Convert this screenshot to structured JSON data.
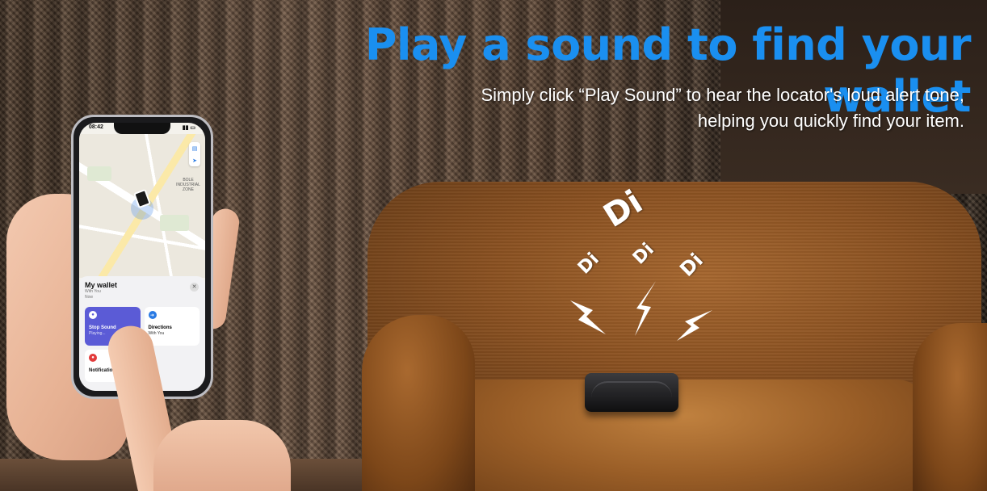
{
  "headline": "Play a sound to find your wallet",
  "subtext_line1": "Simply click “Play Sound” to hear the locator's loud alert tone,",
  "subtext_line2": "helping you quickly find your item.",
  "sound_words": [
    "Di",
    "Di",
    "Di",
    "Di"
  ],
  "colors": {
    "headline": "#1a8ff0",
    "subtext": "#ffffff",
    "tile_active": "#5b5bd6"
  },
  "phone": {
    "time": "08:42",
    "map_labels": [
      "BOLE INDUSTRIAL ZONE"
    ],
    "sheet": {
      "title": "My wallet",
      "subtitle": "With You",
      "time_label": "Now",
      "tiles": [
        {
          "label": "Stop Sound",
          "status": "Playing...",
          "icon": "speaker-icon",
          "active": true
        },
        {
          "label": "Directions",
          "status": "With You",
          "icon": "directions-icon",
          "active": false
        },
        {
          "label": "Notifications",
          "status": "",
          "icon": "bell-icon",
          "active": false
        }
      ]
    }
  }
}
